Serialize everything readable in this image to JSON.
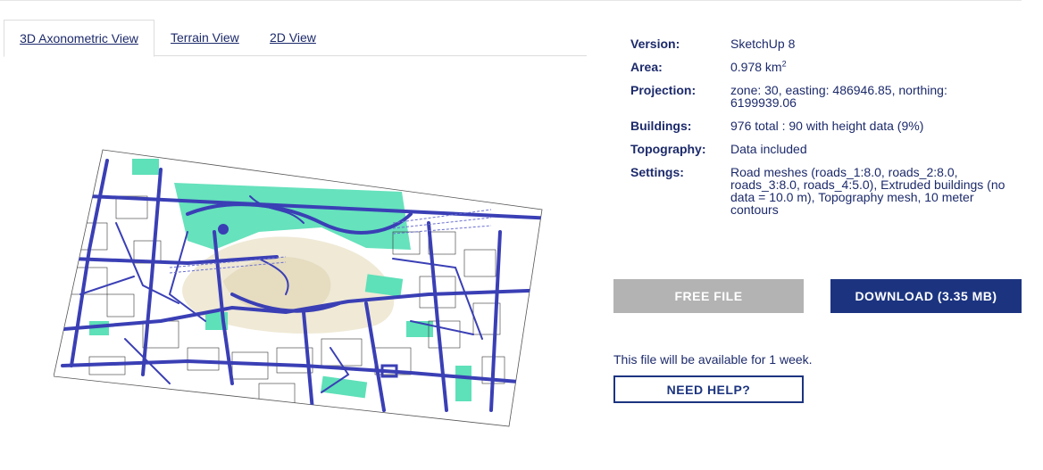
{
  "tabs": [
    {
      "label": "3D Axonometric View",
      "active": true
    },
    {
      "label": "Terrain View",
      "active": false
    },
    {
      "label": "2D View",
      "active": false
    }
  ],
  "info": {
    "version_label": "Version:",
    "version_value": "SketchUp 8",
    "area_label": "Area:",
    "area_value": "0.978 km",
    "area_unit_sup": "2",
    "projection_label": "Projection:",
    "projection_value": "zone: 30, easting: 486946.85, northing: 6199939.06",
    "buildings_label": "Buildings:",
    "buildings_value": "976 total : 90 with height data (9%)",
    "topography_label": "Topography:",
    "topography_value": "Data included",
    "settings_label": "Settings:",
    "settings_value": "Road meshes (roads_1:8.0, roads_2:8.0, roads_3:8.0, roads_4:5.0), Extruded buildings (no data = 10.0 m), Topography mesh, 10 meter contours"
  },
  "buttons": {
    "free_label": "FREE FILE",
    "download_label": "DOWNLOAD (3.35 MB)",
    "help_label": "NEED HELP?"
  },
  "availability_text": "This file will be available for 1 week.",
  "colors": {
    "navy": "#1c2a6b",
    "button_blue": "#1c3480",
    "disabled_grey": "#b3b3b3",
    "map_road": "#3a3fb5",
    "map_park": "#5ee0b8",
    "map_terrain": "#efe9d6"
  }
}
